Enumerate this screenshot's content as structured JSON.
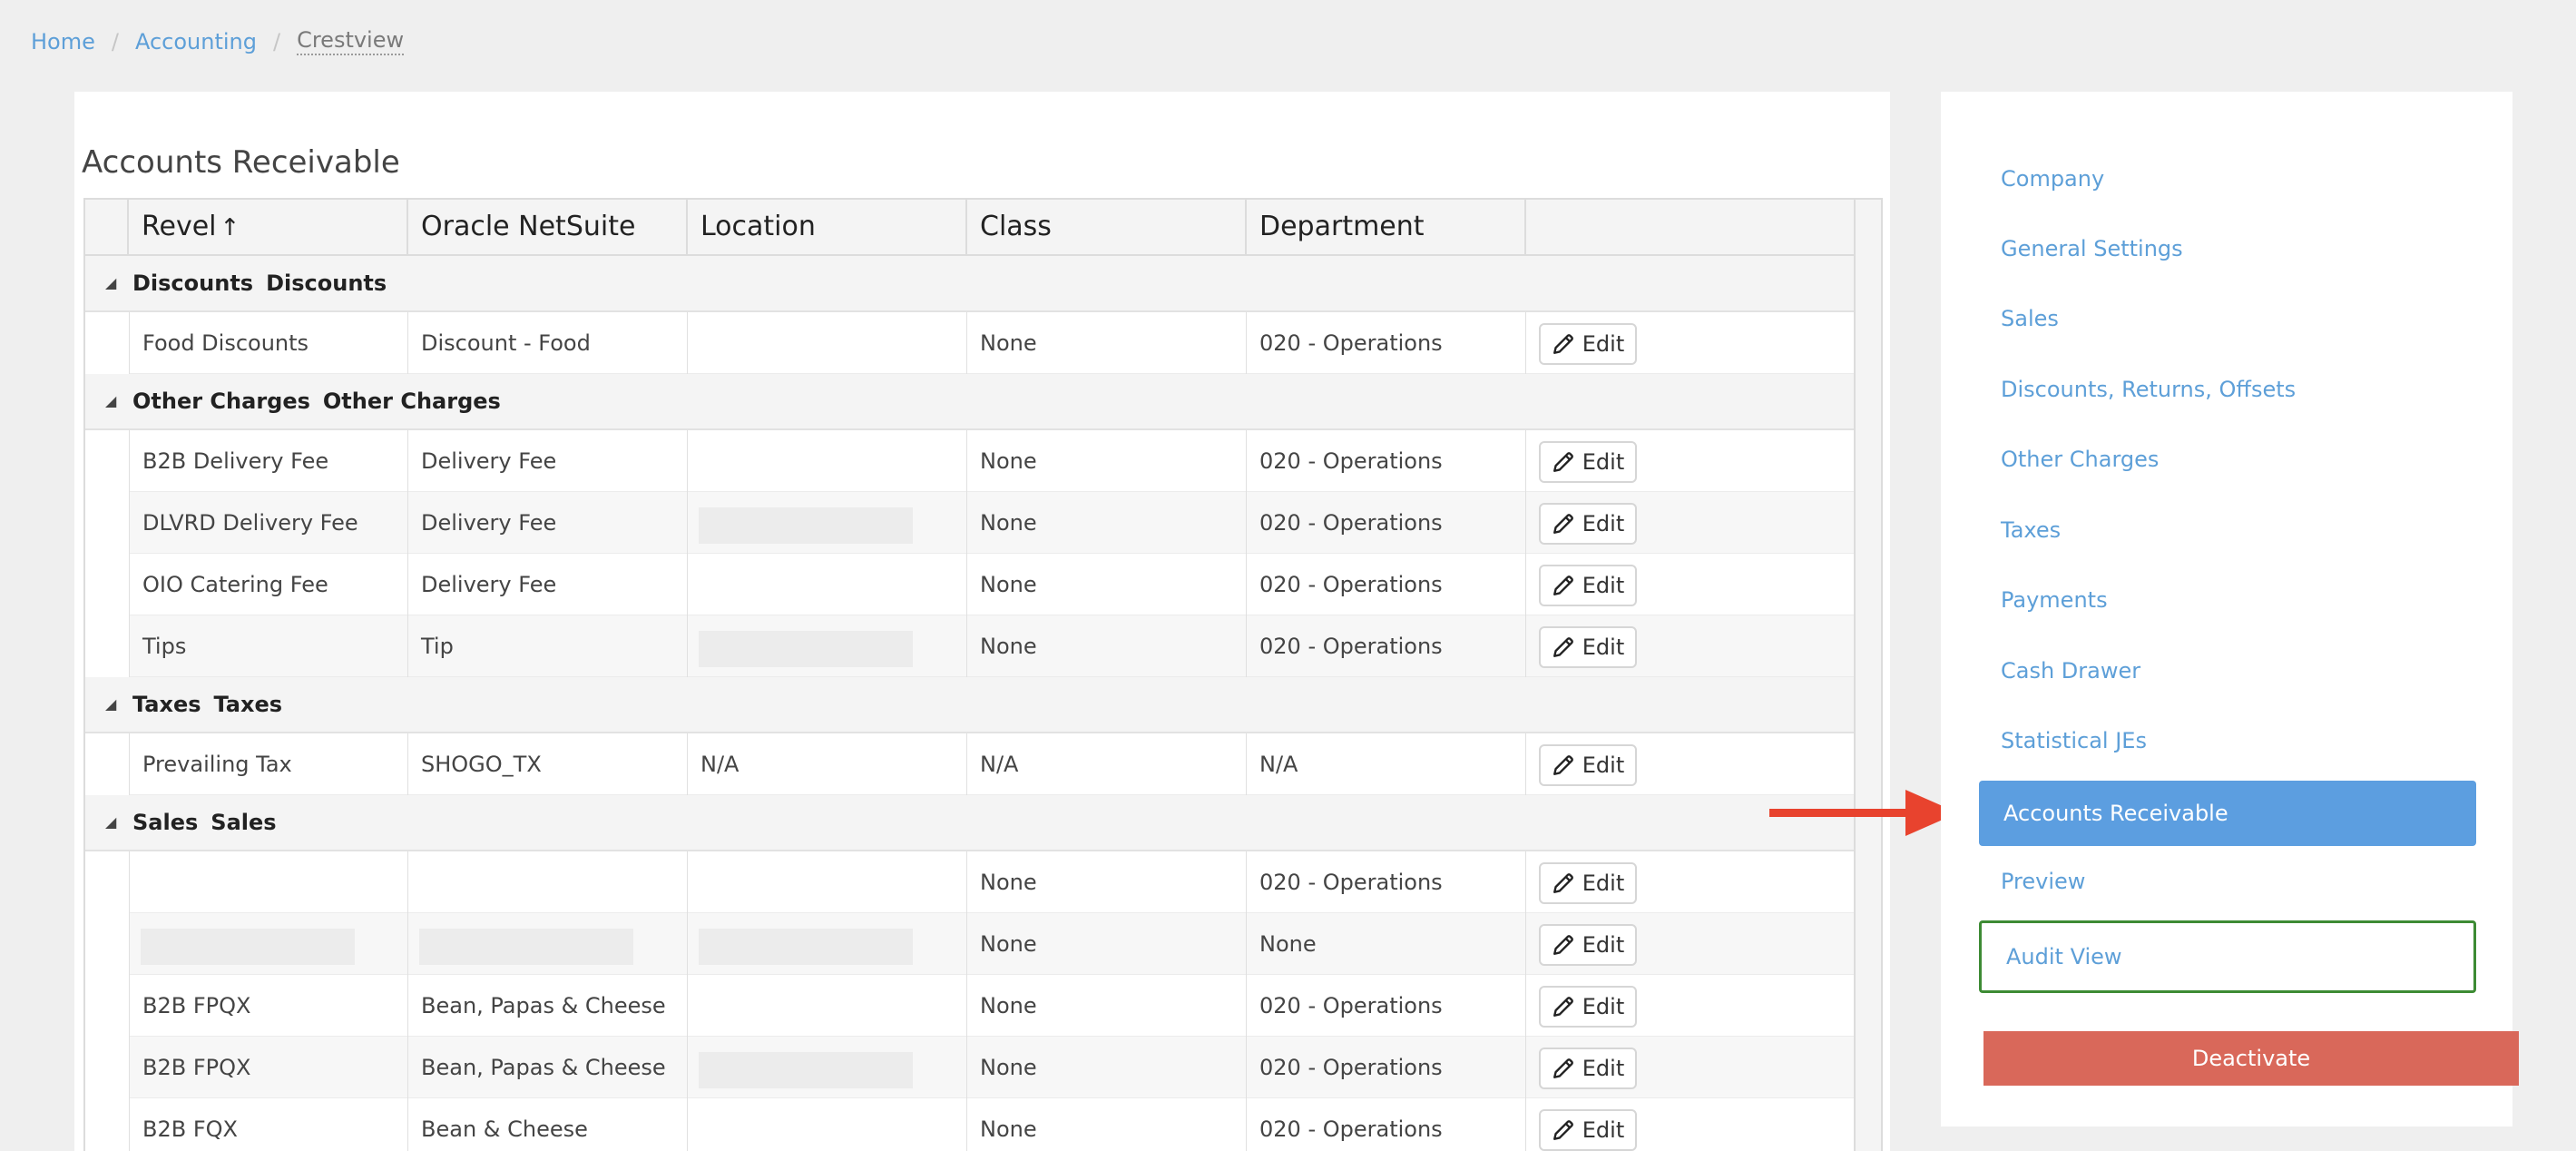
{
  "breadcrumb": {
    "home": "Home",
    "accounting": "Accounting",
    "current": "Crestview",
    "separator": "/"
  },
  "panel": {
    "title": "Accounts Receivable"
  },
  "table": {
    "headers": {
      "revel": "Revel",
      "revel_sort_arrow": "↑",
      "netsuite": "Oracle NetSuite",
      "location": "Location",
      "class": "Class",
      "department": "Department"
    },
    "edit_label": "Edit",
    "groups": [
      {
        "label": "Discounts",
        "label2": "Discounts",
        "toggle": "◢"
      },
      {
        "label": "Other Charges",
        "label2": "Other Charges",
        "toggle": "◢"
      },
      {
        "label": "Taxes",
        "label2": "Taxes",
        "toggle": "◢"
      },
      {
        "label": "Sales",
        "label2": "Sales",
        "toggle": "◢"
      }
    ],
    "rows": [
      {
        "revel": "Food Discounts",
        "netsuite": "Discount - Food",
        "location": "",
        "class": "None",
        "department": "020 - Operations"
      },
      {
        "revel": "B2B Delivery Fee",
        "netsuite": "Delivery Fee",
        "location": "",
        "class": "None",
        "department": "020 - Operations"
      },
      {
        "revel": "DLVRD Delivery Fee",
        "netsuite": "Delivery Fee",
        "location": "",
        "class": "None",
        "department": "020 - Operations"
      },
      {
        "revel": "OIO Catering Fee",
        "netsuite": "Delivery Fee",
        "location": "",
        "class": "None",
        "department": "020 - Operations"
      },
      {
        "revel": "Tips",
        "netsuite": "Tip",
        "location": "",
        "class": "None",
        "department": "020 - Operations"
      },
      {
        "revel": "Prevailing Tax",
        "netsuite": "SHOGO_TX",
        "location": "N/A",
        "class": "N/A",
        "department": "N/A"
      },
      {
        "revel": "",
        "netsuite": "",
        "location": "",
        "class": "None",
        "department": "020 - Operations"
      },
      {
        "revel": "",
        "netsuite": "",
        "location": "",
        "class": "None",
        "department": "None"
      },
      {
        "revel": "B2B FPQX",
        "netsuite": "Bean, Papas & Cheese",
        "location": "",
        "class": "None",
        "department": "020 - Operations"
      },
      {
        "revel": "B2B FPQX",
        "netsuite": "Bean, Papas & Cheese",
        "location": "",
        "class": "None",
        "department": "020 - Operations"
      },
      {
        "revel": "B2B FQX",
        "netsuite": "Bean & Cheese",
        "location": "",
        "class": "None",
        "department": "020 - Operations"
      }
    ]
  },
  "sidebar": {
    "items": [
      "Company",
      "General Settings",
      "Sales",
      "Discounts, Returns, Offsets",
      "Other Charges",
      "Taxes",
      "Payments",
      "Cash Drawer",
      "Statistical JEs"
    ],
    "active": "Accounts Receivable",
    "preview": "Preview",
    "audit": "Audit View",
    "deactivate": "Deactivate"
  },
  "colors": {
    "link": "#5d9fd8",
    "active_nav": "#5c9ee0",
    "audit_border": "#3d8b34",
    "deactivate": "#d9685a",
    "annotation_arrow": "#e8432e"
  },
  "icons": {
    "edit": "pencil-icon",
    "annotation": "red-arrow"
  }
}
